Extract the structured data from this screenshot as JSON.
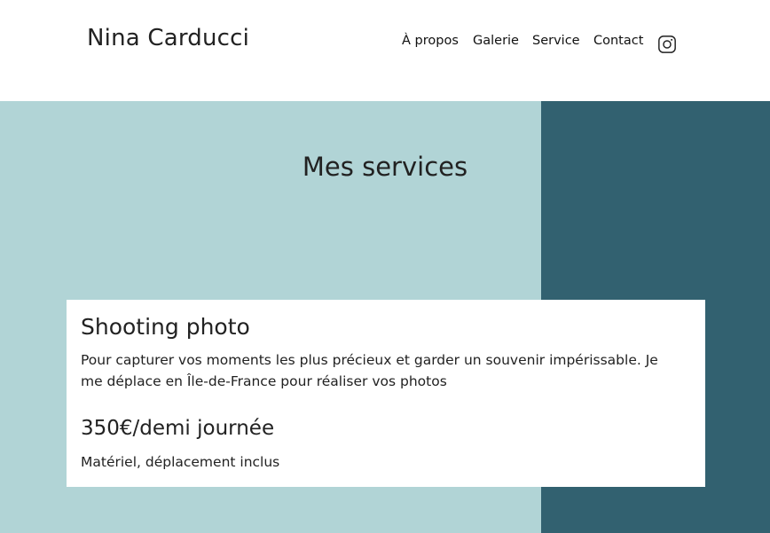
{
  "header": {
    "brand": "Nina Carducci",
    "nav": [
      {
        "label": "À propos"
      },
      {
        "label": "Galerie"
      },
      {
        "label": "Service"
      },
      {
        "label": "Contact"
      }
    ],
    "social_icon": "instagram-icon"
  },
  "services": {
    "title": "Mes services",
    "card": {
      "title": "Shooting photo",
      "description": "Pour capturer vos moments les plus précieux et garder un souvenir impérissable. Je me déplace en Île-de-France pour réaliser vos photos",
      "price": "350€/demi journée",
      "note": "Matériel, déplacement inclus"
    }
  },
  "colors": {
    "hero_left": "#b1d4d6",
    "hero_right": "#326170",
    "card_bg": "#ffffff",
    "text": "#222222"
  }
}
